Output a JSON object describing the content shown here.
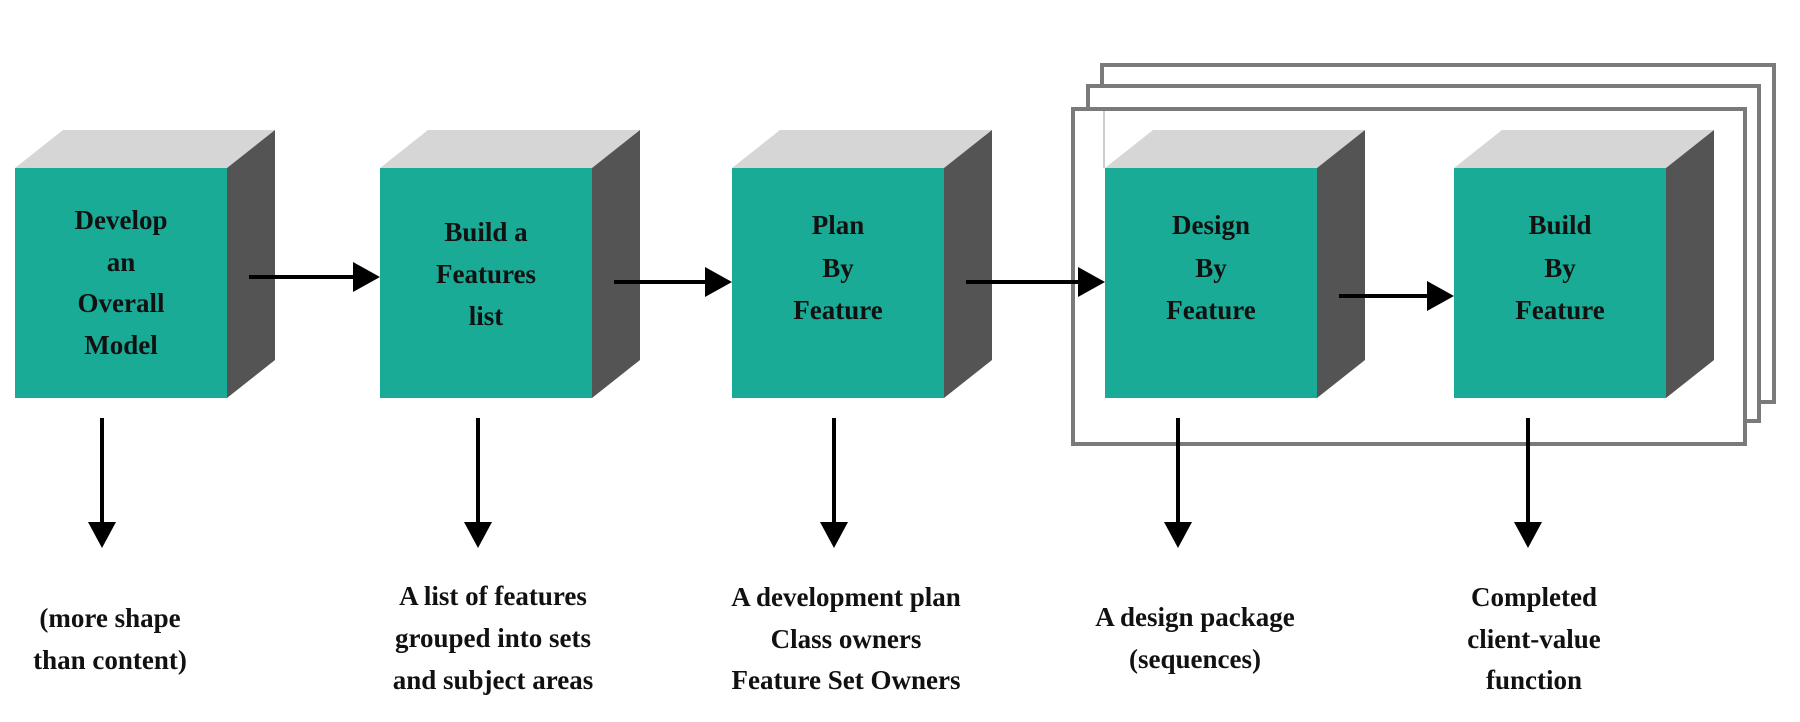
{
  "colors": {
    "front": "#1aab96",
    "top": "#d6d6d6",
    "side": "#545454",
    "frame": "#7a7a7a",
    "arrow": "#000000",
    "text": "#111111"
  },
  "steps": [
    {
      "id": "develop-overall-model",
      "label_lines": [
        "Develop",
        "an",
        "Overall",
        "Model"
      ],
      "output_lines": [
        "(more shape",
        "than content)"
      ]
    },
    {
      "id": "build-features-list",
      "label_lines": [
        "Build a",
        "Features",
        "list"
      ],
      "output_lines": [
        "A list of features",
        "grouped into sets",
        "and subject areas"
      ]
    },
    {
      "id": "plan-by-feature",
      "label_lines": [
        "Plan",
        "By",
        "Feature"
      ],
      "output_lines": [
        "A development plan",
        "Class owners",
        "Feature Set Owners"
      ]
    },
    {
      "id": "design-by-feature",
      "label_lines": [
        "Design",
        "By",
        "Feature"
      ],
      "output_lines": [
        "A design package",
        "(sequences)"
      ]
    },
    {
      "id": "build-by-feature",
      "label_lines": [
        "Build",
        "By",
        "Feature"
      ],
      "output_lines": [
        "Completed",
        "client-value",
        "function"
      ]
    }
  ],
  "iteration_group": {
    "description": "stacked frames around iterative steps",
    "contains_steps": [
      "design-by-feature",
      "build-by-feature"
    ],
    "stack_count": 3
  }
}
